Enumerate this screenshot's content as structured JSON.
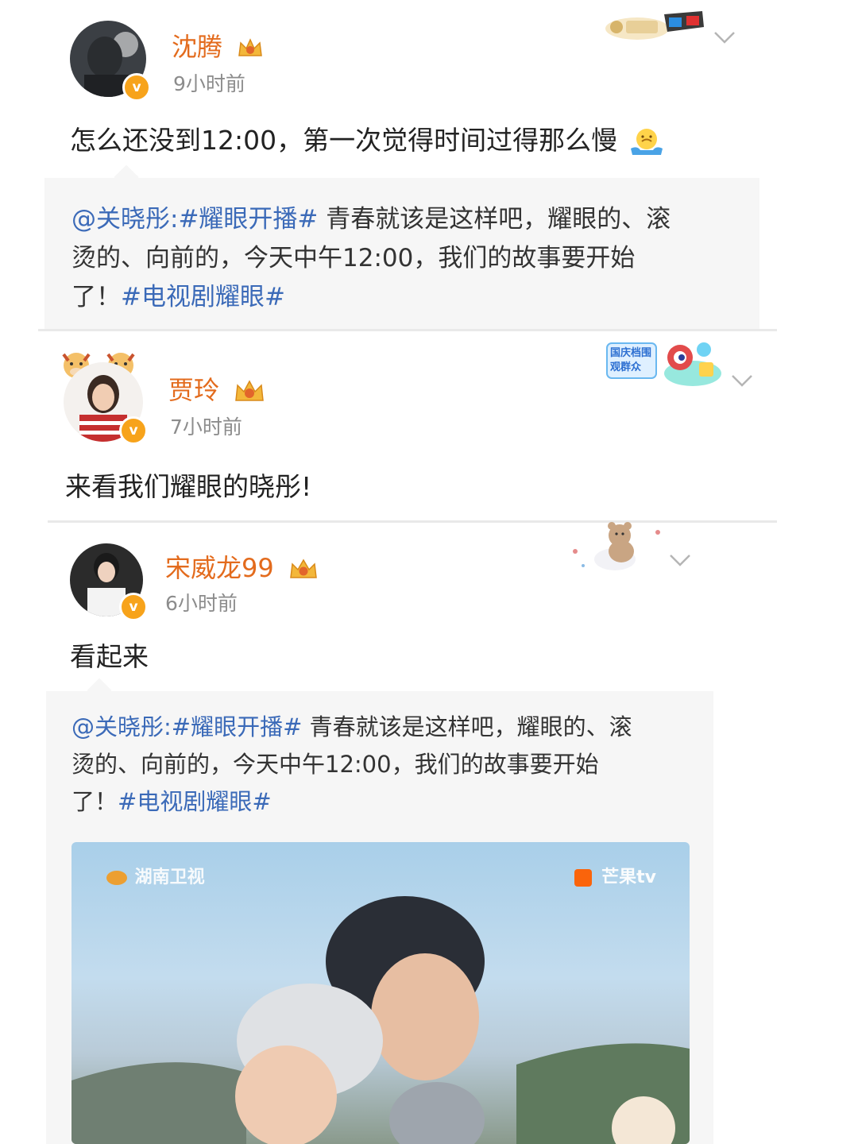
{
  "posts": [
    {
      "username": "沈腾",
      "time": "9小时前",
      "text": "怎么还没到12:00，第一次觉得时间过得那么慢",
      "badge_icon": "movie-3d-glasses-badge",
      "repost": {
        "author": "@关晓彤:",
        "tag1": "#耀眼开播#",
        "line1_rest": " 青春就该是这样吧，耀眼的、滚",
        "line2": "烫的、向前的，今天中午12:00，我们的故事要开始",
        "line3_prefix": "了！",
        "tag2": "#电视剧耀眼#"
      }
    },
    {
      "username": "贾玲",
      "time": "7小时前",
      "text": "来看我们耀眼的晓彤!",
      "badge_text": "国庆档围观群众"
    },
    {
      "username": "宋威龙99",
      "time": "6小时前",
      "text": "看起来",
      "badge_icon": "teddy-bear-badge",
      "repost": {
        "author": "@关晓彤:",
        "tag1": "#耀眼开播#",
        "line1_rest": " 青春就该是这样吧，耀眼的、滚",
        "line2": "烫的、向前的，今天中午12:00，我们的故事要开始",
        "line3_prefix": "了！",
        "tag2": "#电视剧耀眼#"
      },
      "media": {
        "logo_left": "湖南卫视",
        "logo_right": "芒果tv"
      }
    }
  ],
  "colors": {
    "username": "#e36b1d",
    "link": "#3b6ab8",
    "verified": "#f7a31b"
  }
}
